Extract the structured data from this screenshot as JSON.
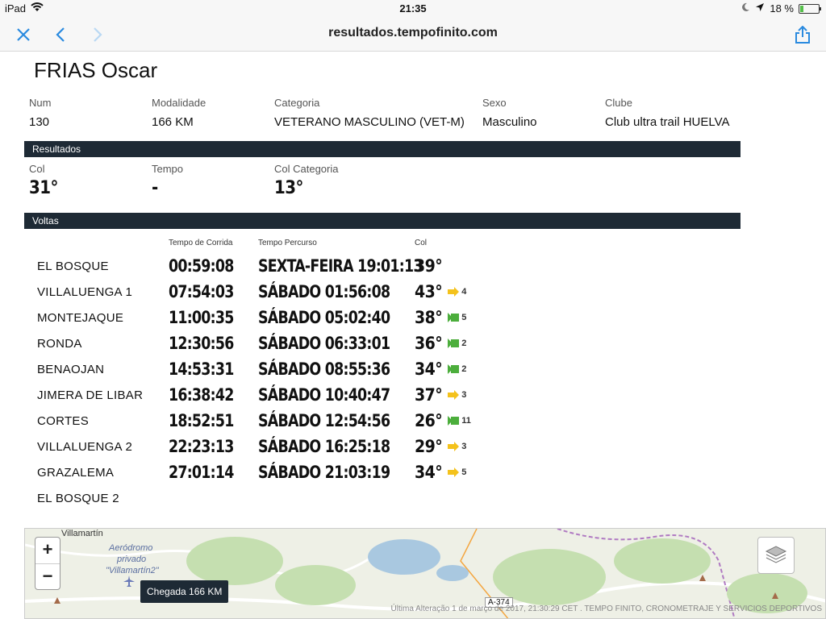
{
  "statusbar": {
    "device": "iPad",
    "time": "21:35",
    "battery": "18 %",
    "battery_level": 0.18
  },
  "browser": {
    "url": "resultados.tempofinito.com"
  },
  "athlete": {
    "name": "FRIAS Oscar",
    "fields": [
      {
        "label": "Num",
        "value": "130"
      },
      {
        "label": "Modalidade",
        "value": "166 KM"
      },
      {
        "label": "Categoria",
        "value": "VETERANO MASCULINO (VET-M)"
      },
      {
        "label": "Sexo",
        "value": "Masculino"
      },
      {
        "label": "Clube",
        "value": "Club ultra trail HUELVA"
      }
    ]
  },
  "results": {
    "title": "Resultados",
    "fields": [
      {
        "label": "Col",
        "value": "31°"
      },
      {
        "label": "Tempo",
        "value": "-"
      },
      {
        "label": "Col Categoria",
        "value": "13°"
      }
    ]
  },
  "laps": {
    "title": "Voltas",
    "headers": {
      "race_time": "Tempo de Corrida",
      "course_time": "Tempo Percurso",
      "col": "Col"
    },
    "rows": [
      {
        "name": "EL BOSQUE",
        "race_time": "00:59:08",
        "course_time": "SEXTA-FEIRA 19:01:13",
        "col": "39°",
        "trend": "",
        "delta": ""
      },
      {
        "name": "VILLALUENGA 1",
        "race_time": "07:54:03",
        "course_time": "SÁBADO 01:56:08",
        "col": "43°",
        "trend": "down",
        "delta": "4"
      },
      {
        "name": "MONTEJAQUE",
        "race_time": "11:00:35",
        "course_time": "SÁBADO 05:02:40",
        "col": "38°",
        "trend": "up",
        "delta": "5"
      },
      {
        "name": "RONDA",
        "race_time": "12:30:56",
        "course_time": "SÁBADO 06:33:01",
        "col": "36°",
        "trend": "up",
        "delta": "2"
      },
      {
        "name": "BENAOJAN",
        "race_time": "14:53:31",
        "course_time": "SÁBADO 08:55:36",
        "col": "34°",
        "trend": "up",
        "delta": "2"
      },
      {
        "name": "JIMERA DE LIBAR",
        "race_time": "16:38:42",
        "course_time": "SÁBADO 10:40:47",
        "col": "37°",
        "trend": "down",
        "delta": "3"
      },
      {
        "name": "CORTES",
        "race_time": "18:52:51",
        "course_time": "SÁBADO 12:54:56",
        "col": "26°",
        "trend": "up",
        "delta": "11"
      },
      {
        "name": "VILLALUENGA 2",
        "race_time": "22:23:13",
        "course_time": "SÁBADO 16:25:18",
        "col": "29°",
        "trend": "down",
        "delta": "3"
      },
      {
        "name": "GRAZALEMA",
        "race_time": "27:01:14",
        "course_time": "SÁBADO 21:03:19",
        "col": "34°",
        "trend": "down",
        "delta": "5"
      },
      {
        "name": "EL BOSQUE 2",
        "race_time": "",
        "course_time": "",
        "col": "",
        "trend": "",
        "delta": ""
      }
    ]
  },
  "map": {
    "zoom_in": "+",
    "zoom_out": "−",
    "tooltip": "Chegada 166 KM",
    "labels": {
      "town": "Villamartín",
      "airfield_1": "Aeródromo",
      "airfield_2": "privado",
      "airfield_3": "\"Villamartín2\"",
      "road": "A-374"
    },
    "attribution": "Última Alteração 1 de março de 2017, 21:30:29 CET . TEMPO FINITO, CRONOMETRAJE Y SERVICIOS DEPORTIVOS"
  },
  "colors": {
    "accent": "#2a8adf",
    "bar": "#1e2a35",
    "trend_up": "#4cae3c",
    "trend_down": "#f4c21c"
  }
}
